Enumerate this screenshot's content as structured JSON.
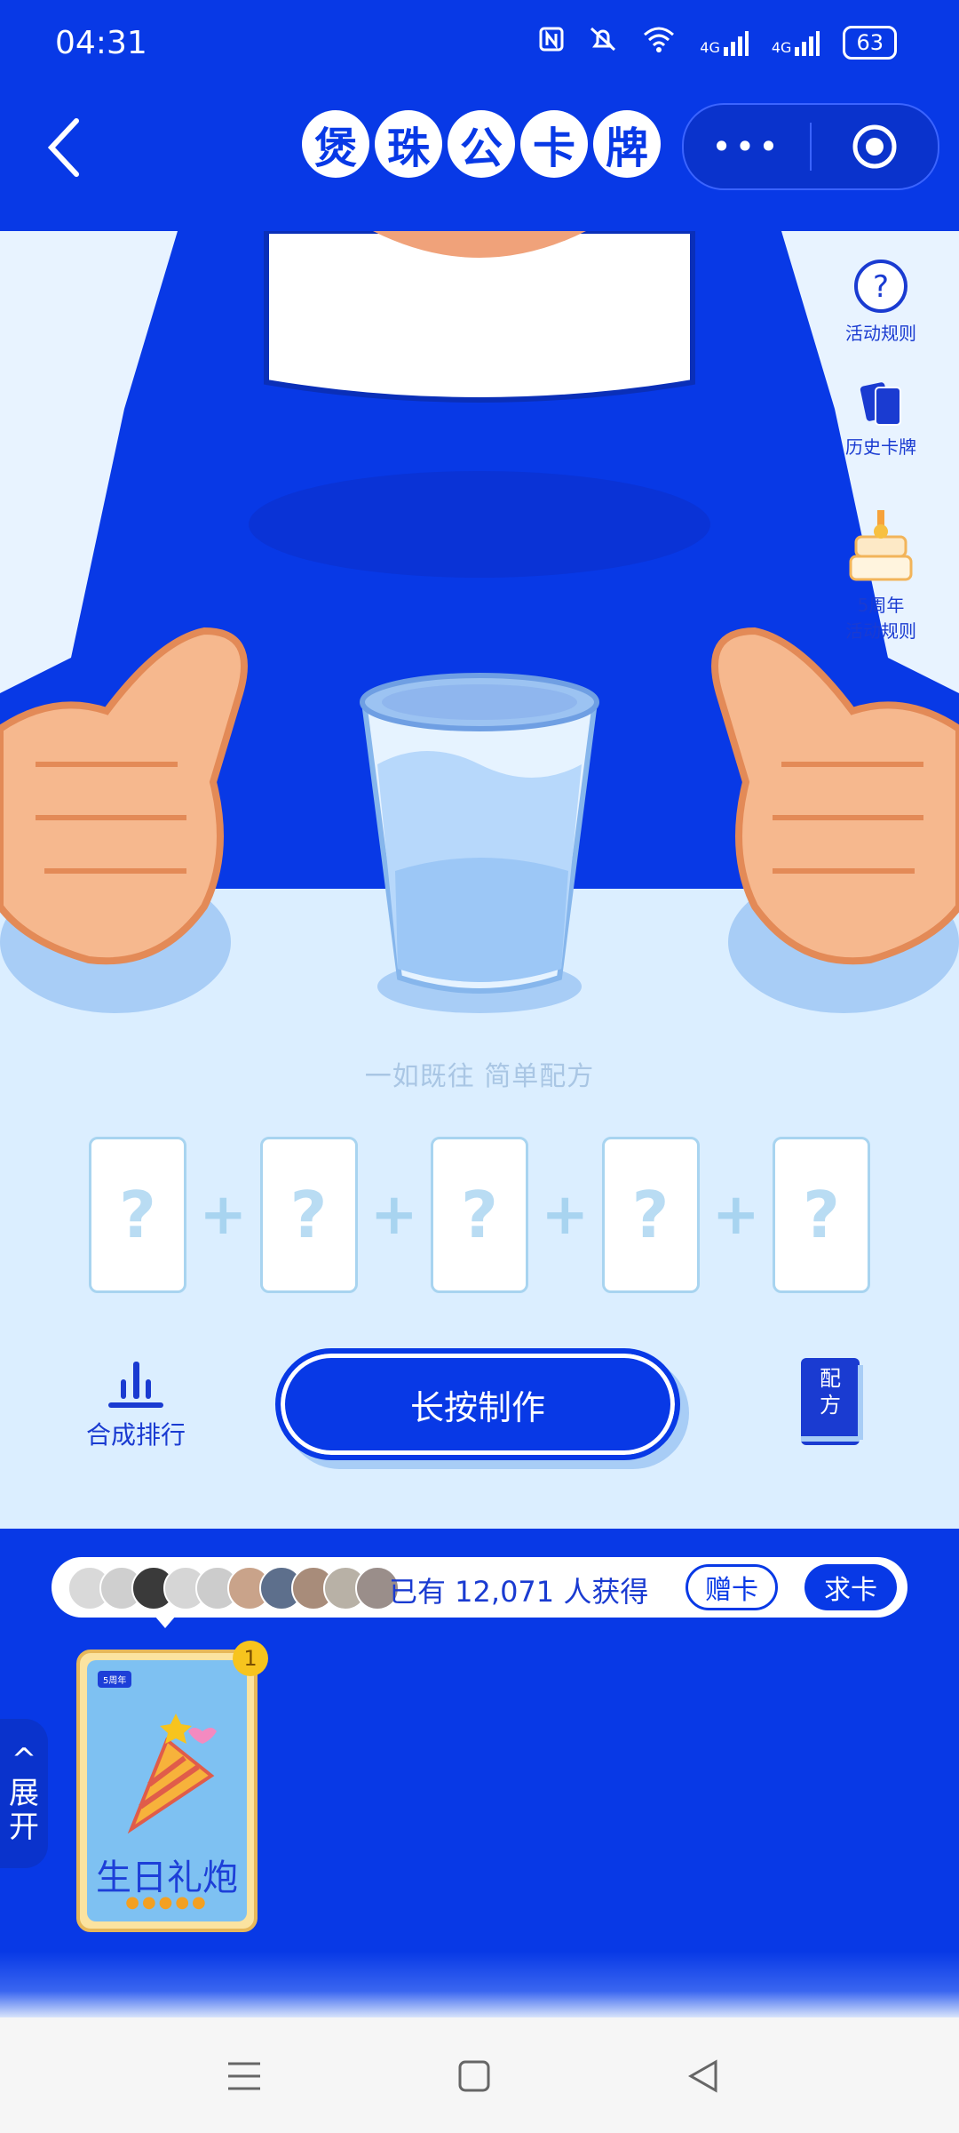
{
  "status_bar": {
    "time": "04:31",
    "net1": "4G",
    "net2": "4G",
    "battery": "63",
    "icons": [
      "nfc-icon",
      "mute-icon",
      "wifi-icon",
      "signal-icon",
      "signal-icon",
      "battery-icon"
    ]
  },
  "header": {
    "title_chars": [
      "煲",
      "珠",
      "公",
      "卡",
      "牌"
    ],
    "more_label": "•••"
  },
  "side_menu": {
    "rules": "活动规则",
    "history": "历史卡牌",
    "anniv_line1": "5周年",
    "anniv_line2": "活动规则"
  },
  "main": {
    "subtitle": "一如既往 简单配方",
    "slot_mark": "?",
    "plus": "+",
    "rank_label": "合成排行",
    "make_label": "长按制作",
    "recipe_line1": "配",
    "recipe_line2": "方"
  },
  "info_bar": {
    "got_text": "已有 12,071 人获得",
    "give_label": "赠卡",
    "ask_label": "求卡"
  },
  "card": {
    "tag": "5周年",
    "name": "生日礼炮",
    "count": "1",
    "stars": "●●●●●"
  },
  "expand": {
    "arrow": "^",
    "line1": "展",
    "line2": "开"
  },
  "colors": {
    "brand_blue": "#0839e6",
    "light_blue": "#dbeeff",
    "card_gold": "#e7b85a"
  }
}
